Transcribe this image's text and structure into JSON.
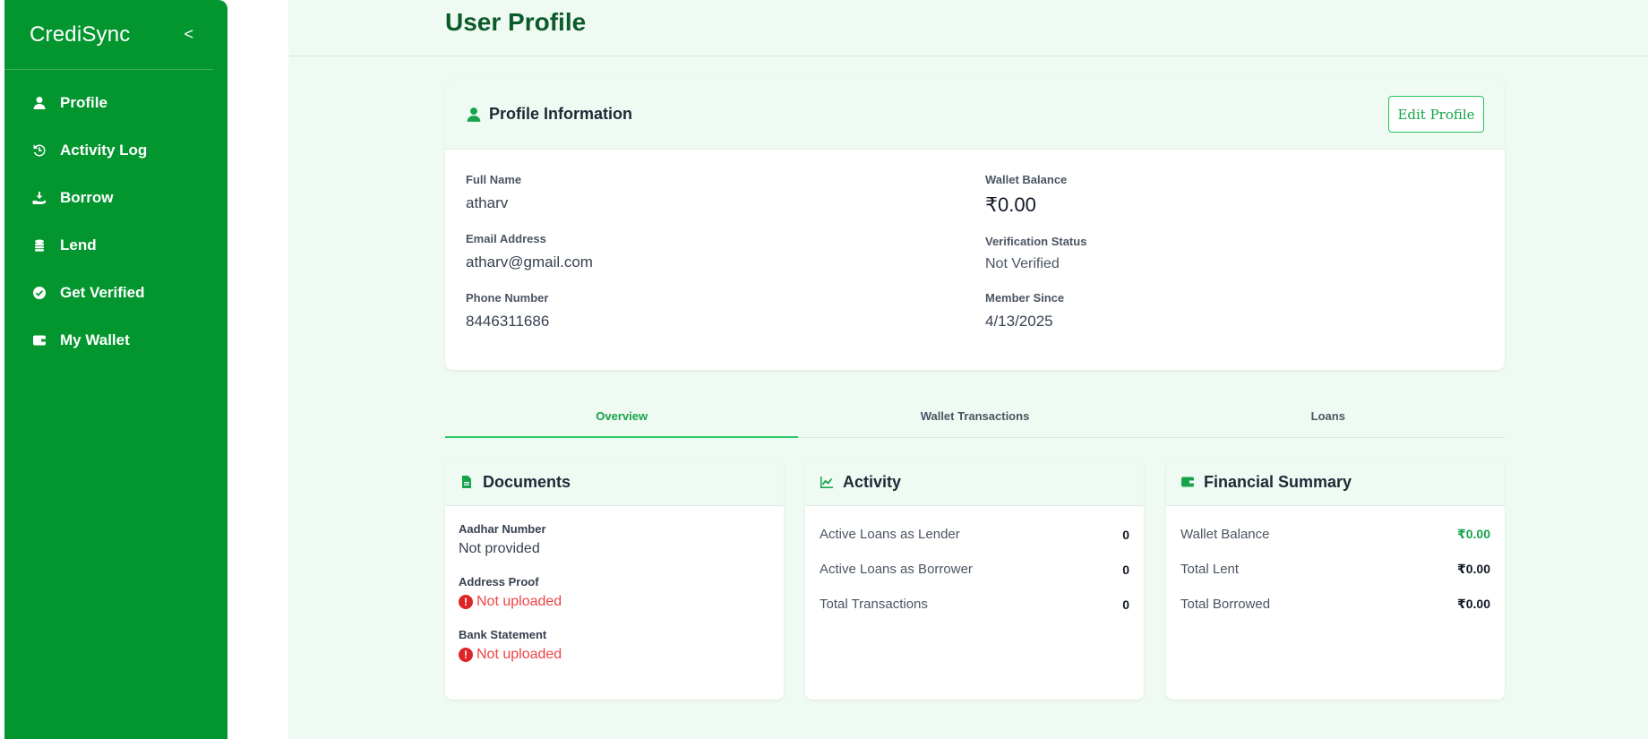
{
  "sidebar": {
    "brand": "CrediSync",
    "collapse": "<",
    "items": [
      {
        "label": "Profile",
        "icon": "user-icon"
      },
      {
        "label": "Activity Log",
        "icon": "history-icon"
      },
      {
        "label": "Borrow",
        "icon": "hand-money-icon"
      },
      {
        "label": "Lend",
        "icon": "coins-icon"
      },
      {
        "label": "Get Verified",
        "icon": "check-circle-icon"
      },
      {
        "label": "My Wallet",
        "icon": "wallet-icon"
      }
    ]
  },
  "header": {
    "title": "User Profile"
  },
  "profile": {
    "title": "Profile Information",
    "edit_label": "Edit Profile",
    "full_name_label": "Full Name",
    "full_name": "atharv",
    "email_label": "Email Address",
    "email": "atharv@gmail.com",
    "phone_label": "Phone Number",
    "phone": "8446311686",
    "wallet_label": "Wallet Balance",
    "wallet": "₹0.00",
    "verification_label": "Verification Status",
    "verification": "Not Verified",
    "member_label": "Member Since",
    "member": "4/13/2025"
  },
  "tabs": [
    {
      "label": "Overview",
      "active": true
    },
    {
      "label": "Wallet Transactions",
      "active": false
    },
    {
      "label": "Loans",
      "active": false
    }
  ],
  "documents": {
    "title": "Documents",
    "aadhar_label": "Aadhar Number",
    "aadhar_value": "Not provided",
    "address_label": "Address Proof",
    "address_value": "Not uploaded",
    "bank_label": "Bank Statement",
    "bank_value": "Not uploaded",
    "alert_glyph": "!"
  },
  "activity": {
    "title": "Activity",
    "rows": [
      {
        "label": "Active Loans as Lender",
        "value": "0"
      },
      {
        "label": "Active Loans as Borrower",
        "value": "0"
      },
      {
        "label": "Total Transactions",
        "value": "0"
      }
    ]
  },
  "financial": {
    "title": "Financial Summary",
    "rows": [
      {
        "label": "Wallet Balance",
        "value": "₹0.00"
      },
      {
        "label": "Total Lent",
        "value": "₹0.00"
      },
      {
        "label": "Total Borrowed",
        "value": "₹0.00"
      }
    ]
  },
  "colors": {
    "sidebar": "#03962f",
    "accent": "#16a34a",
    "error": "#ef4444",
    "main_bg": "#effaf2"
  }
}
